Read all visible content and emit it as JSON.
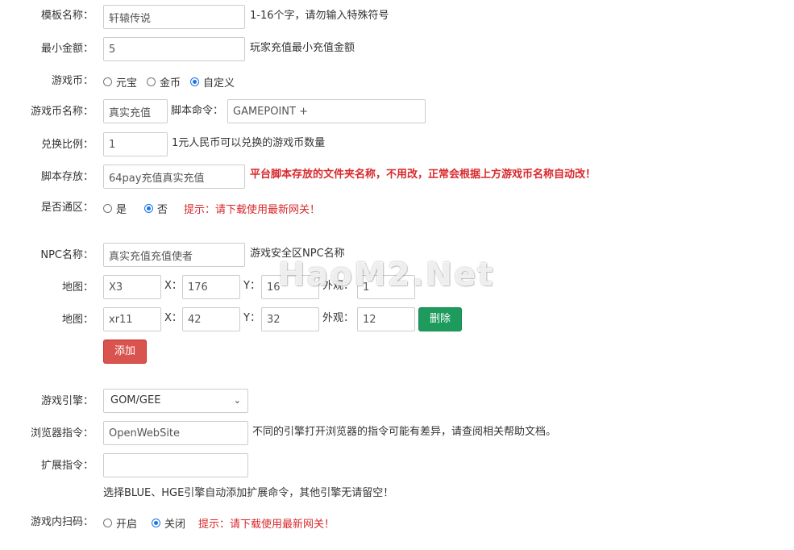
{
  "template_name": {
    "label": "模板名称：",
    "value": "轩辕传说",
    "hint": "1-16个字，请勿输入特殊符号"
  },
  "min_amount": {
    "label": "最小金额：",
    "value": "5",
    "hint": "玩家充值最小充值金额"
  },
  "game_currency": {
    "label": "游戏币：",
    "options": [
      "元宝",
      "金币",
      "自定义"
    ],
    "selected": "自定义"
  },
  "currency_name": {
    "label": "游戏币名称：",
    "value": "真实充值",
    "script_label": "脚本命令：",
    "script_value": "GAMEPOINT +"
  },
  "exchange_ratio": {
    "label": "兑换比例：",
    "value": "1",
    "hint": "1元人民币可以兑换的游戏币数量"
  },
  "script_storage": {
    "label": "脚本存放：",
    "value": "64pay充值真实充值",
    "hint": "平台脚本存放的文件夹名称，不用改，正常会根据上方游戏币名称自动改！"
  },
  "all_zones": {
    "label": "是否通区：",
    "options": [
      "是",
      "否"
    ],
    "selected": "否",
    "tip": "提示：请下载使用最新网关！"
  },
  "npc_name": {
    "label": "NPC名称：",
    "value": "真实充值充值使者",
    "hint": "游戏安全区NPC名称"
  },
  "maps": {
    "label": "地图：",
    "x_label": "X：",
    "y_label": "Y：",
    "look_label": "外观：",
    "rows": [
      {
        "map": "X3",
        "x": "176",
        "y": "16",
        "look": "1"
      },
      {
        "map": "xr11",
        "x": "42",
        "y": "32",
        "look": "12"
      }
    ],
    "delete_label": "删除",
    "add_label": "添加"
  },
  "engine": {
    "label": "游戏引擎：",
    "value": "GOM/GEE",
    "caret": "⌄"
  },
  "browser_cmd": {
    "label": "浏览器指令：",
    "value": "OpenWebSite",
    "hint": "不同的引擎打开浏览器的指令可能有差异，请查阅相关帮助文档。"
  },
  "ext_cmd": {
    "label": "扩展指令：",
    "value": "",
    "hint": "选择BLUE、HGE引擎自动添加扩展命令，其他引擎无请留空！"
  },
  "qr_scan": {
    "label": "游戏内扫码：",
    "options": [
      "开启",
      "关闭"
    ],
    "selected": "关闭",
    "tip": "提示：请下载使用最新网关！"
  },
  "watermark": "HaoM2.Net"
}
